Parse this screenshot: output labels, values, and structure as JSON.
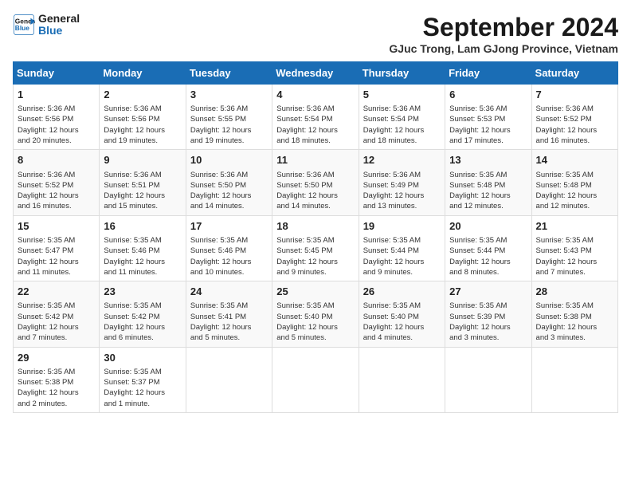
{
  "header": {
    "logo_line1": "General",
    "logo_line2": "Blue",
    "month_title": "September 2024",
    "subtitle": "GJuc Trong, Lam GJong Province, Vietnam"
  },
  "columns": [
    "Sunday",
    "Monday",
    "Tuesday",
    "Wednesday",
    "Thursday",
    "Friday",
    "Saturday"
  ],
  "weeks": [
    [
      {
        "day": "1",
        "info": "Sunrise: 5:36 AM\nSunset: 5:56 PM\nDaylight: 12 hours\nand 20 minutes."
      },
      {
        "day": "2",
        "info": "Sunrise: 5:36 AM\nSunset: 5:56 PM\nDaylight: 12 hours\nand 19 minutes."
      },
      {
        "day": "3",
        "info": "Sunrise: 5:36 AM\nSunset: 5:55 PM\nDaylight: 12 hours\nand 19 minutes."
      },
      {
        "day": "4",
        "info": "Sunrise: 5:36 AM\nSunset: 5:54 PM\nDaylight: 12 hours\nand 18 minutes."
      },
      {
        "day": "5",
        "info": "Sunrise: 5:36 AM\nSunset: 5:54 PM\nDaylight: 12 hours\nand 18 minutes."
      },
      {
        "day": "6",
        "info": "Sunrise: 5:36 AM\nSunset: 5:53 PM\nDaylight: 12 hours\nand 17 minutes."
      },
      {
        "day": "7",
        "info": "Sunrise: 5:36 AM\nSunset: 5:52 PM\nDaylight: 12 hours\nand 16 minutes."
      }
    ],
    [
      {
        "day": "8",
        "info": "Sunrise: 5:36 AM\nSunset: 5:52 PM\nDaylight: 12 hours\nand 16 minutes."
      },
      {
        "day": "9",
        "info": "Sunrise: 5:36 AM\nSunset: 5:51 PM\nDaylight: 12 hours\nand 15 minutes."
      },
      {
        "day": "10",
        "info": "Sunrise: 5:36 AM\nSunset: 5:50 PM\nDaylight: 12 hours\nand 14 minutes."
      },
      {
        "day": "11",
        "info": "Sunrise: 5:36 AM\nSunset: 5:50 PM\nDaylight: 12 hours\nand 14 minutes."
      },
      {
        "day": "12",
        "info": "Sunrise: 5:36 AM\nSunset: 5:49 PM\nDaylight: 12 hours\nand 13 minutes."
      },
      {
        "day": "13",
        "info": "Sunrise: 5:35 AM\nSunset: 5:48 PM\nDaylight: 12 hours\nand 12 minutes."
      },
      {
        "day": "14",
        "info": "Sunrise: 5:35 AM\nSunset: 5:48 PM\nDaylight: 12 hours\nand 12 minutes."
      }
    ],
    [
      {
        "day": "15",
        "info": "Sunrise: 5:35 AM\nSunset: 5:47 PM\nDaylight: 12 hours\nand 11 minutes."
      },
      {
        "day": "16",
        "info": "Sunrise: 5:35 AM\nSunset: 5:46 PM\nDaylight: 12 hours\nand 11 minutes."
      },
      {
        "day": "17",
        "info": "Sunrise: 5:35 AM\nSunset: 5:46 PM\nDaylight: 12 hours\nand 10 minutes."
      },
      {
        "day": "18",
        "info": "Sunrise: 5:35 AM\nSunset: 5:45 PM\nDaylight: 12 hours\nand 9 minutes."
      },
      {
        "day": "19",
        "info": "Sunrise: 5:35 AM\nSunset: 5:44 PM\nDaylight: 12 hours\nand 9 minutes."
      },
      {
        "day": "20",
        "info": "Sunrise: 5:35 AM\nSunset: 5:44 PM\nDaylight: 12 hours\nand 8 minutes."
      },
      {
        "day": "21",
        "info": "Sunrise: 5:35 AM\nSunset: 5:43 PM\nDaylight: 12 hours\nand 7 minutes."
      }
    ],
    [
      {
        "day": "22",
        "info": "Sunrise: 5:35 AM\nSunset: 5:42 PM\nDaylight: 12 hours\nand 7 minutes."
      },
      {
        "day": "23",
        "info": "Sunrise: 5:35 AM\nSunset: 5:42 PM\nDaylight: 12 hours\nand 6 minutes."
      },
      {
        "day": "24",
        "info": "Sunrise: 5:35 AM\nSunset: 5:41 PM\nDaylight: 12 hours\nand 5 minutes."
      },
      {
        "day": "25",
        "info": "Sunrise: 5:35 AM\nSunset: 5:40 PM\nDaylight: 12 hours\nand 5 minutes."
      },
      {
        "day": "26",
        "info": "Sunrise: 5:35 AM\nSunset: 5:40 PM\nDaylight: 12 hours\nand 4 minutes."
      },
      {
        "day": "27",
        "info": "Sunrise: 5:35 AM\nSunset: 5:39 PM\nDaylight: 12 hours\nand 3 minutes."
      },
      {
        "day": "28",
        "info": "Sunrise: 5:35 AM\nSunset: 5:38 PM\nDaylight: 12 hours\nand 3 minutes."
      }
    ],
    [
      {
        "day": "29",
        "info": "Sunrise: 5:35 AM\nSunset: 5:38 PM\nDaylight: 12 hours\nand 2 minutes."
      },
      {
        "day": "30",
        "info": "Sunrise: 5:35 AM\nSunset: 5:37 PM\nDaylight: 12 hours\nand 1 minute."
      },
      {
        "day": "",
        "info": ""
      },
      {
        "day": "",
        "info": ""
      },
      {
        "day": "",
        "info": ""
      },
      {
        "day": "",
        "info": ""
      },
      {
        "day": "",
        "info": ""
      }
    ]
  ]
}
